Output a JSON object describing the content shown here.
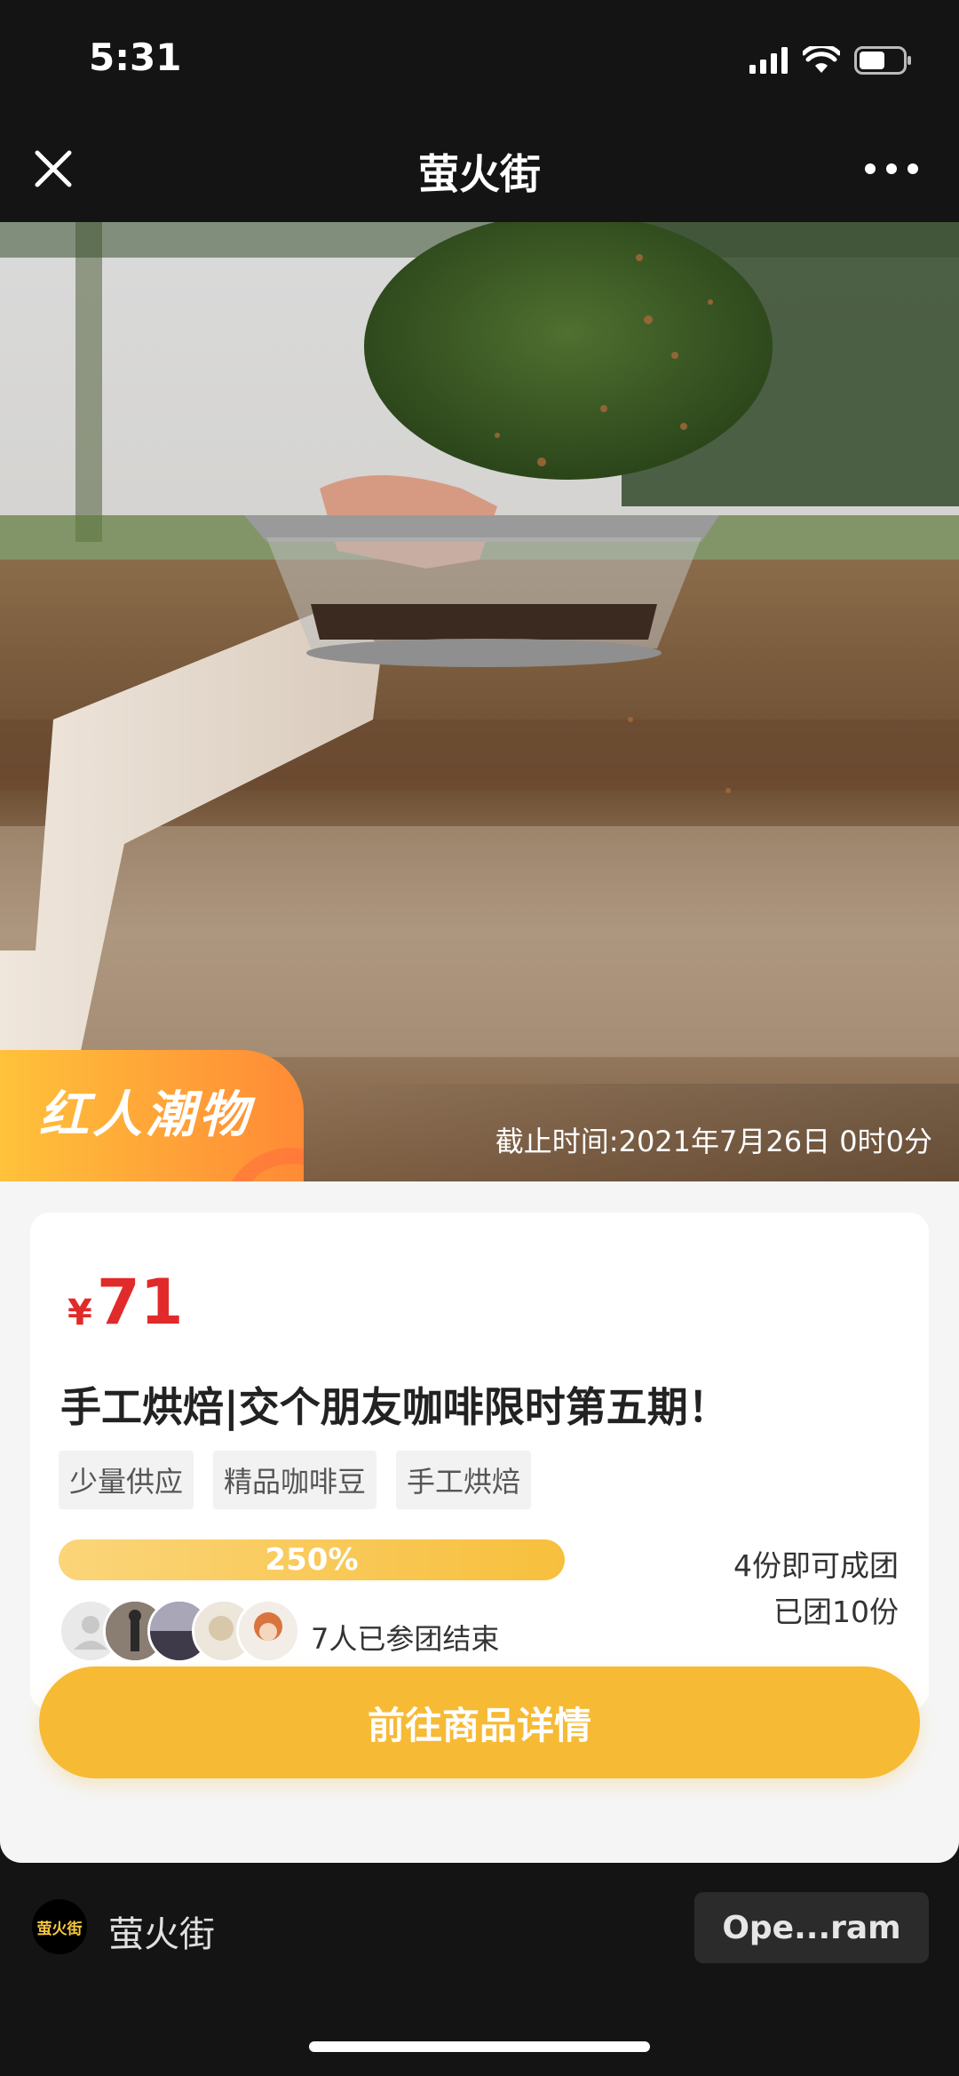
{
  "status_bar": {
    "time": "5:31",
    "battery_level": 0.6
  },
  "nav": {
    "title": "萤火街"
  },
  "hero": {
    "badge": "红人潮物",
    "deadline": "截止时间:2021年7月26日 0时0分"
  },
  "product": {
    "currency": "¥",
    "price": "71",
    "title": "手工烘焙|交个朋友咖啡限时第五期！",
    "tags": [
      "少量供应",
      "精品咖啡豆",
      "手工烘焙"
    ],
    "progress_label": "250%",
    "progress_fraction": 1.0,
    "group_min": "4份即可成团",
    "group_done": "已团10份",
    "joined_text": "7人已参团结束"
  },
  "cta": {
    "label": "前往商品详情"
  },
  "footer": {
    "logo_text": "萤火街",
    "app_name": "萤火街",
    "open_label": "Ope...ram"
  },
  "colors": {
    "accent": "#f6ba35",
    "price": "#e12a2a",
    "badge_start": "#ffc23a",
    "badge_end": "#ff8a36"
  }
}
